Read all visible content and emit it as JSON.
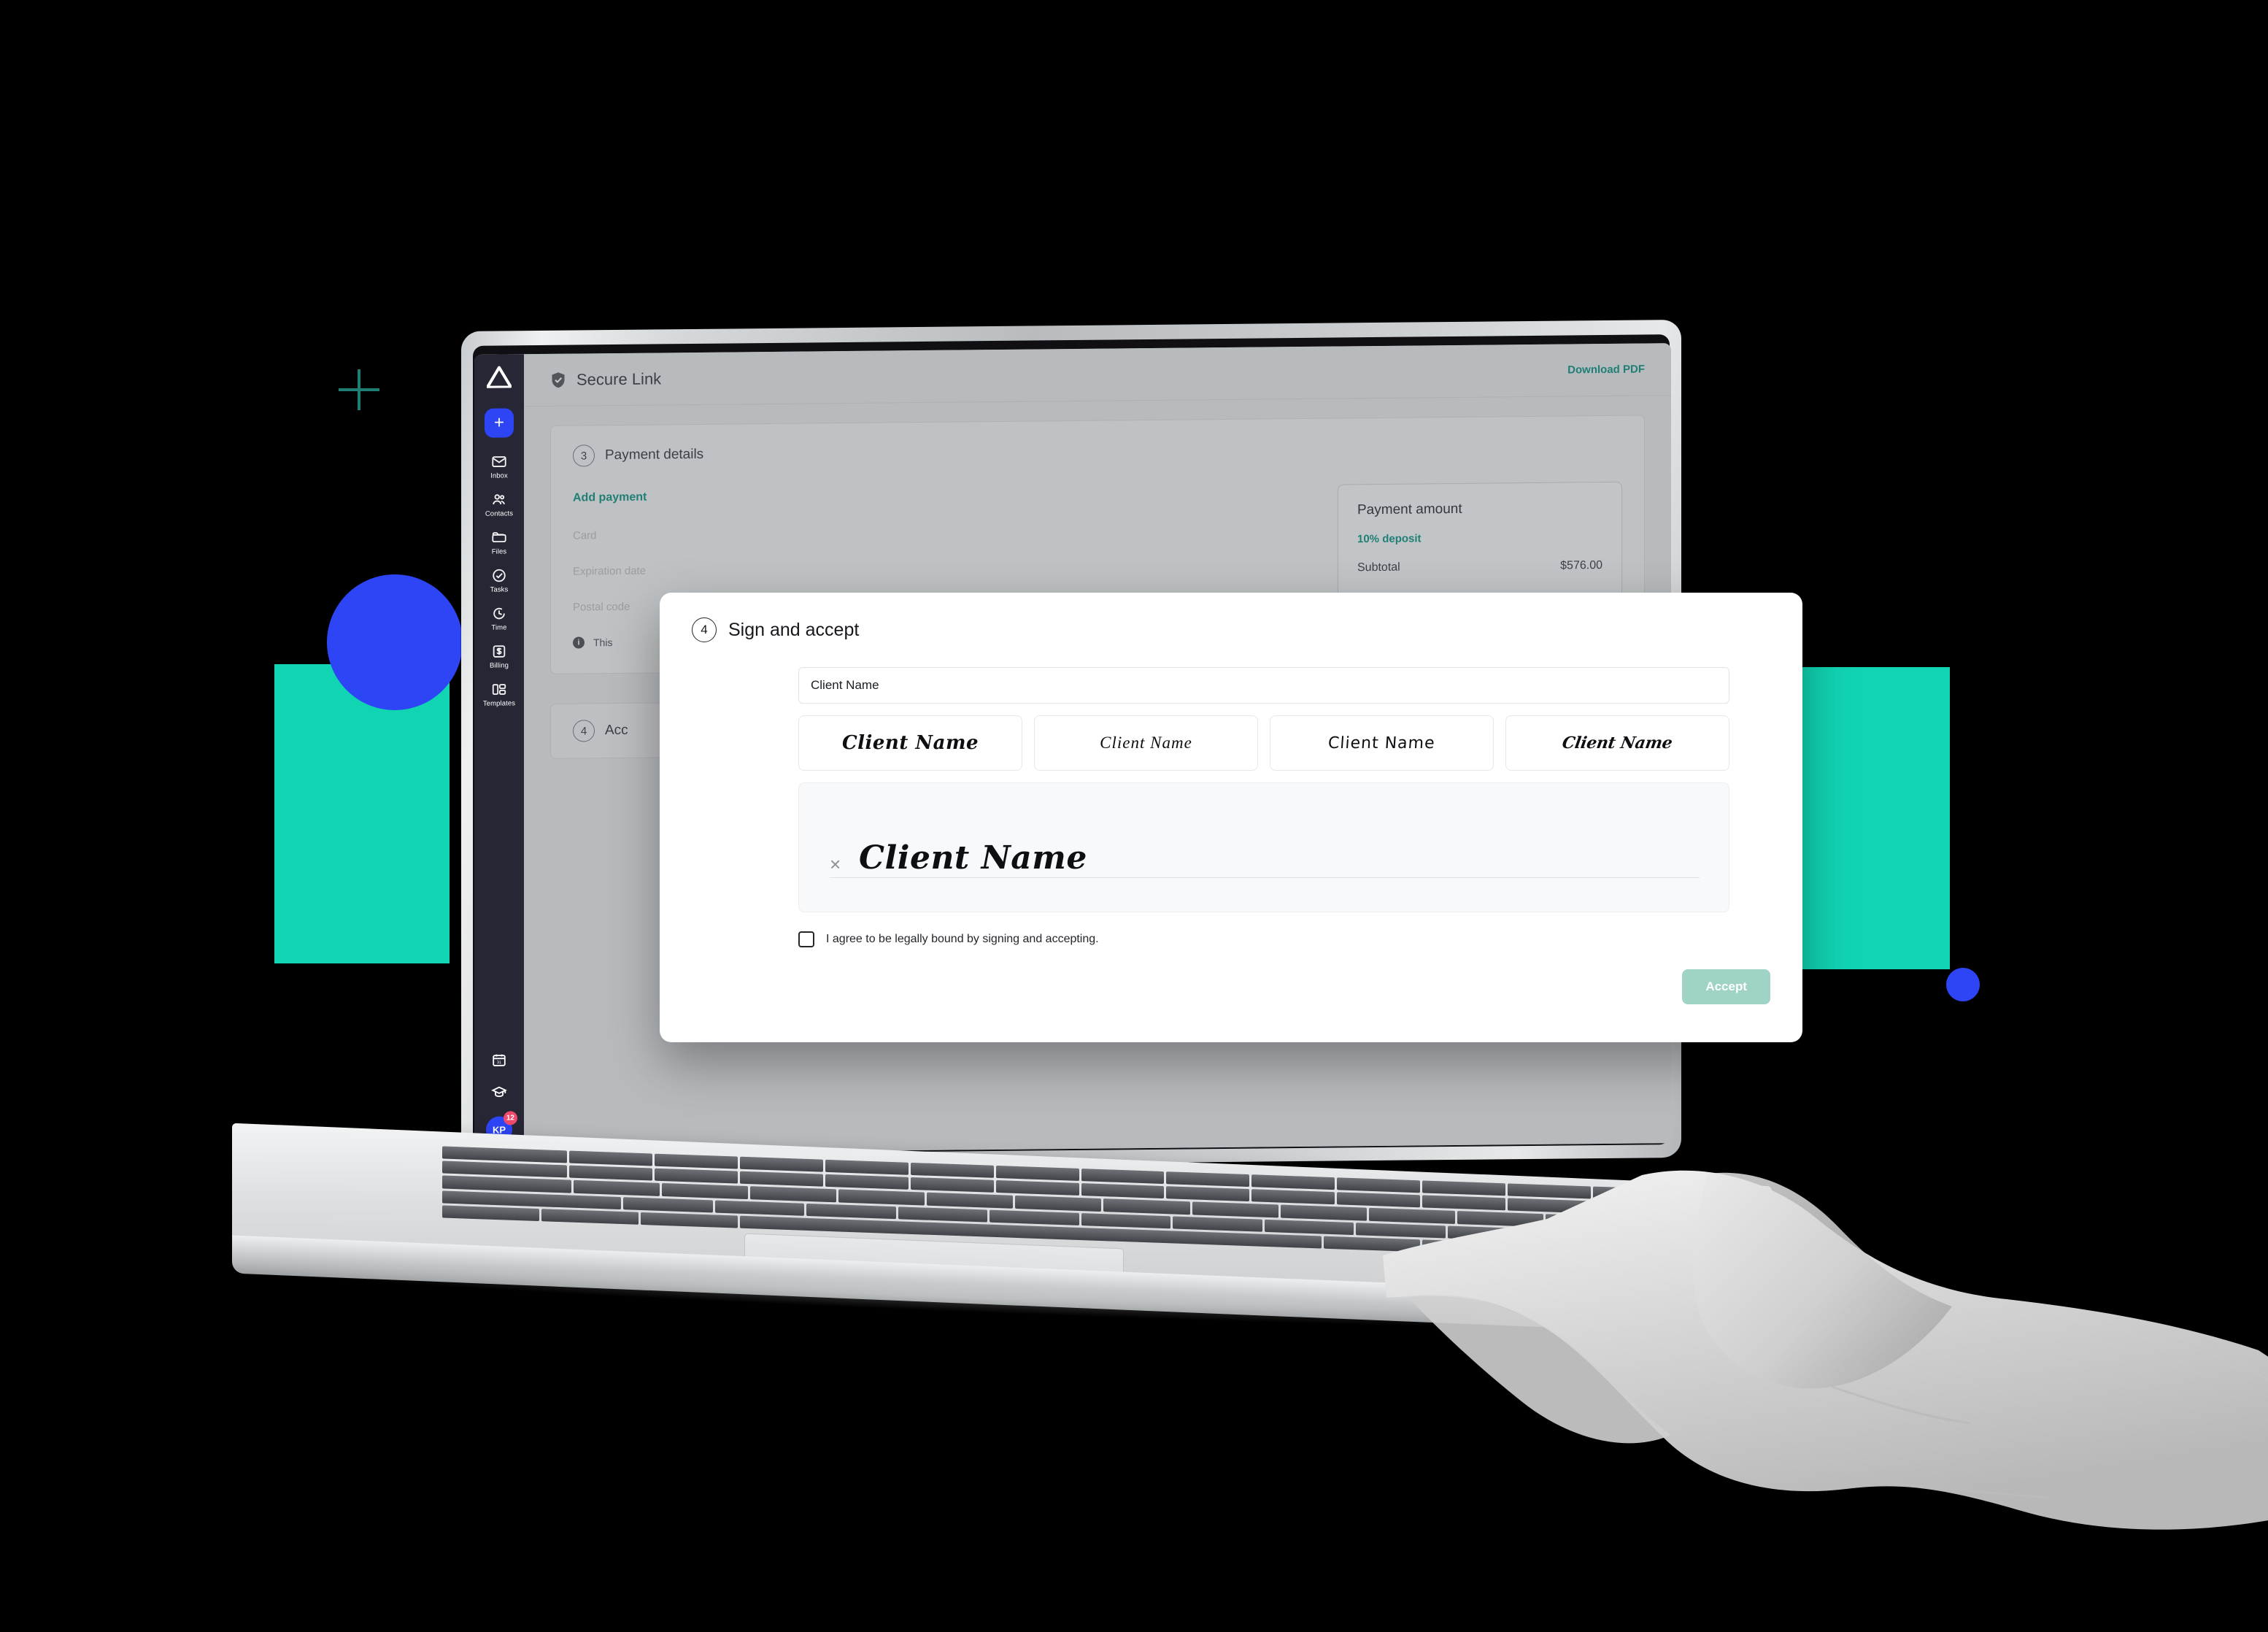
{
  "sidebar": {
    "logo": "triangle-logo",
    "add_button_label": "+",
    "items": [
      {
        "label": "Inbox",
        "icon": "envelope-icon"
      },
      {
        "label": "Contacts",
        "icon": "people-icon"
      },
      {
        "label": "Files",
        "icon": "folder-icon"
      },
      {
        "label": "Tasks",
        "icon": "check-circle-icon"
      },
      {
        "label": "Time",
        "icon": "timer-icon"
      },
      {
        "label": "Billing",
        "icon": "dollar-box-icon"
      },
      {
        "label": "Templates",
        "icon": "layout-icon"
      }
    ],
    "bottom": {
      "calendar_icon": "calendar-31-icon",
      "learning_icon": "graduation-cap-icon",
      "avatar_initials": "KP",
      "notification_count": "12"
    }
  },
  "topbar": {
    "shield_icon": "shield-check-icon",
    "title": "Secure Link",
    "download_label": "Download PDF"
  },
  "payment_section": {
    "step": "3",
    "title": "Payment details",
    "add_payment_label": "Add payment",
    "fields": [
      "Card",
      "Expiration date",
      "Postal code"
    ],
    "info_icon": "info-icon",
    "info_text": "This",
    "amount_box": {
      "title": "Payment amount",
      "deposit_label": "10% deposit",
      "rows": [
        {
          "label": "Subtotal",
          "value": "$576.00"
        }
      ]
    }
  },
  "accept_section": {
    "step": "4",
    "title": "Acc"
  },
  "modal": {
    "step": "4",
    "title": "Sign and accept",
    "name_input_value": "Client Name",
    "signature_options": [
      "Client Name",
      "Client Name",
      "Client Name",
      "Client Name"
    ],
    "signature_canvas": {
      "x_mark": "×",
      "value": "Client Name"
    },
    "agree_label": "I agree to be legally bound by signing and accepting.",
    "accept_label": "Accept"
  },
  "colors": {
    "accent_teal": "#1f7f75",
    "brand_blue": "#2D45F5",
    "deco_teal": "#11D4B3",
    "badge_red": "#F04A6B",
    "sidebar_dark": "#262635",
    "accept_button": "#9ed3c6"
  }
}
